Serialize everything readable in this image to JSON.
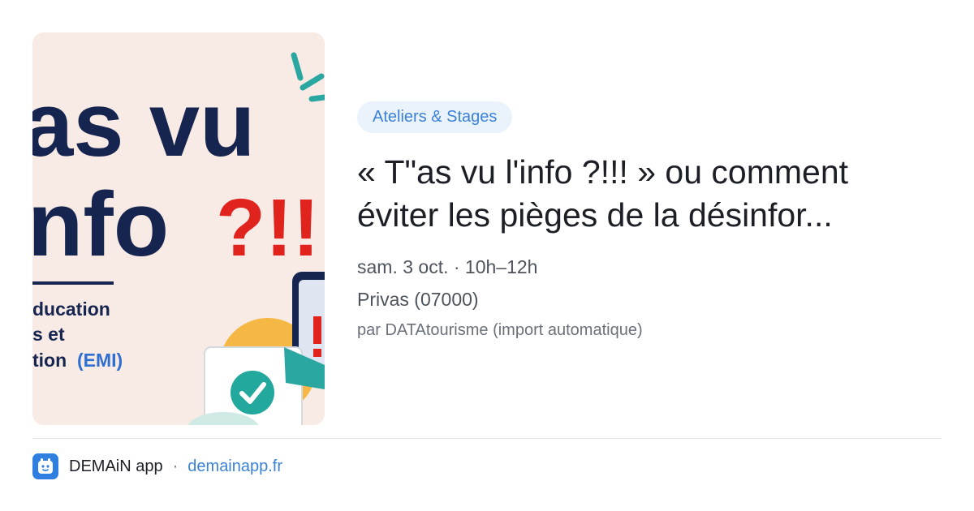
{
  "thumbnail": {
    "headline_1": "as vu",
    "headline_2": "nfo",
    "headline_3": "?!!",
    "sub_1": "ducation",
    "sub_2": "s et",
    "sub_3": "tion",
    "sub_3b": "(EMI)"
  },
  "event": {
    "category": "Ateliers & Stages",
    "title_line1": "« T\"as vu l'info ?!!! » ou comment",
    "title_line2": "éviter les pièges de la désinfor...",
    "datetime": "sam. 3 oct. · 10h–12h",
    "location": "Privas (07000)",
    "source": "par DATAtourisme (import automatique)"
  },
  "footer": {
    "app_name": "DEMAiN app",
    "separator": "·",
    "site": "demainapp.fr"
  },
  "colors": {
    "accent": "#3b82d6",
    "chip_bg": "#eaf2fc",
    "thumb_navy": "#16254f",
    "thumb_red": "#e0231c",
    "thumb_teal": "#2aa7a0"
  }
}
